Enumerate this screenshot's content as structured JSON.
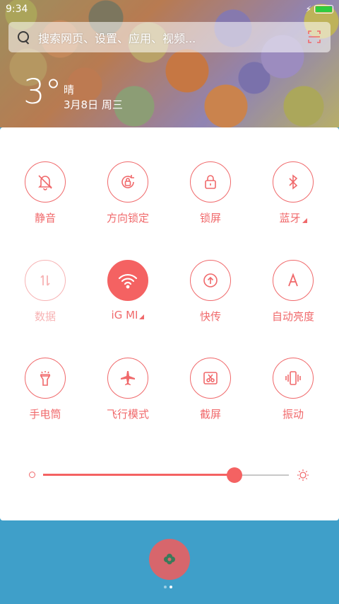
{
  "status_bar": {
    "time": "9:34",
    "battery_level": 1.0
  },
  "search": {
    "placeholder": "搜索网页、设置、应用、视频..."
  },
  "weather": {
    "temperature": "3°",
    "condition": "晴",
    "date": "3月8日 周三"
  },
  "toggles": [
    {
      "label": "静音",
      "icon": "bell-off-icon",
      "active": false
    },
    {
      "label": "方向锁定",
      "icon": "rotation-lock-icon",
      "active": false
    },
    {
      "label": "锁屏",
      "icon": "lock-icon",
      "active": false
    },
    {
      "label": "蓝牙",
      "icon": "bluetooth-icon",
      "active": false,
      "has_menu": true
    },
    {
      "label": "数据",
      "icon": "mobile-data-icon",
      "active": false,
      "disabled": true
    },
    {
      "label": "iG MI",
      "icon": "wifi-icon",
      "active": true,
      "has_menu": true
    },
    {
      "label": "快传",
      "icon": "share-upload-icon",
      "active": false
    },
    {
      "label": "自动亮度",
      "icon": "auto-brightness-icon",
      "active": false
    },
    {
      "label": "手电筒",
      "icon": "flashlight-icon",
      "active": false
    },
    {
      "label": "飞行模式",
      "icon": "airplane-icon",
      "active": false
    },
    {
      "label": "截屏",
      "icon": "screenshot-icon",
      "active": false
    },
    {
      "label": "振动",
      "icon": "vibrate-icon",
      "active": false
    }
  ],
  "brightness": {
    "level": 0.78
  },
  "pager": {
    "pages": 2,
    "current": 2
  },
  "colors": {
    "accent": "#f46262",
    "dock_bg": "#3f9fc9",
    "fab": "#d7666c"
  }
}
